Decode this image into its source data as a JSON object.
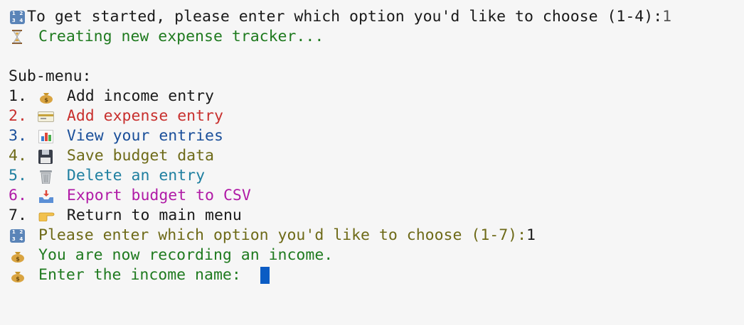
{
  "colors": {
    "default": "#1a1a1a",
    "green": "#1f7a1f",
    "red": "#c8302e",
    "blue": "#1a4f9a",
    "olive": "#6e6a18",
    "teal": "#1f7fa0",
    "magenta": "#b01aa6",
    "cursor": "#0b5cc4"
  },
  "terminal": {
    "prompt_start": {
      "icon": "keypad-1234-icon",
      "text": "To get started, please enter which option you'd like to choose (1-4):",
      "input": "1"
    },
    "status_creating": {
      "icon": "hourglass-icon",
      "text": "Creating new expense tracker..."
    },
    "submenu_title": "Sub-menu:",
    "menu_items": [
      {
        "num": "1.",
        "icon": "money-bag-icon",
        "label": "Add income entry"
      },
      {
        "num": "2.",
        "icon": "credit-card-icon",
        "label": "Add expense entry"
      },
      {
        "num": "3.",
        "icon": "bar-chart-icon",
        "label": "View your entries"
      },
      {
        "num": "4.",
        "icon": "floppy-disk-icon",
        "label": "Save budget data"
      },
      {
        "num": "5.",
        "icon": "wastebasket-icon",
        "label": "Delete an entry"
      },
      {
        "num": "6.",
        "icon": "inbox-tray-icon",
        "label": "Export budget to CSV"
      },
      {
        "num": "7.",
        "icon": "pointing-hand-icon",
        "label": "Return to main menu"
      }
    ],
    "prompt_submenu": {
      "icon": "keypad-1234-icon",
      "text": "Please enter which option you'd like to choose (1-7):",
      "input": "1"
    },
    "status_recording": {
      "icon": "money-bag-icon",
      "text": "You are now recording an income."
    },
    "prompt_income_name": {
      "icon": "money-bag-icon",
      "text": "Enter the income name: "
    }
  }
}
